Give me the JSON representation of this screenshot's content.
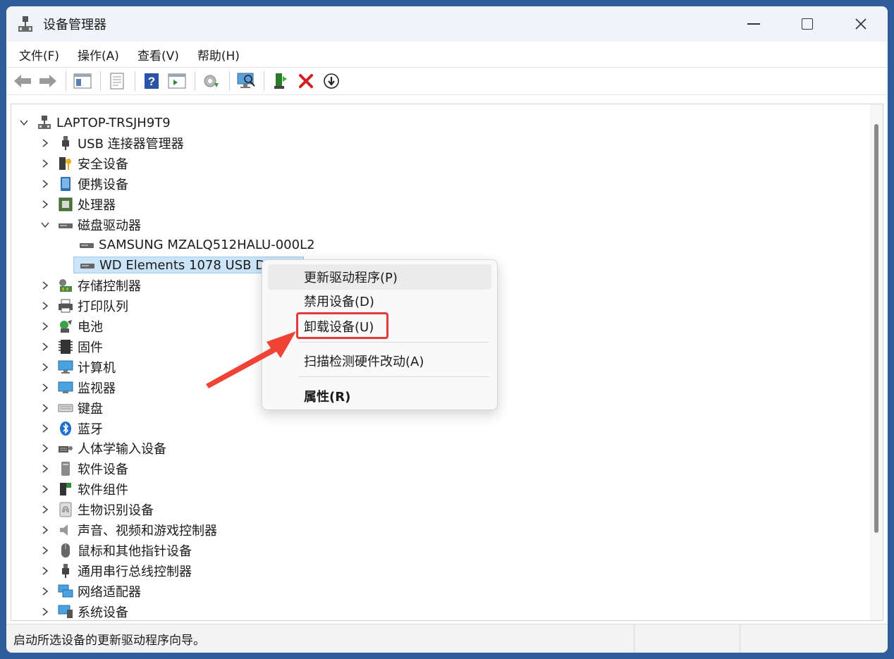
{
  "window": {
    "title": "设备管理器"
  },
  "menubar": [
    "文件(F)",
    "操作(A)",
    "查看(V)",
    "帮助(H)"
  ],
  "tree": {
    "root": "LAPTOP-TRSJH9T9",
    "items": [
      {
        "label": "USB 连接器管理器",
        "icon": "usb-connector-icon",
        "expanded": false
      },
      {
        "label": "安全设备",
        "icon": "security-device-icon",
        "expanded": false
      },
      {
        "label": "便携设备",
        "icon": "portable-device-icon",
        "expanded": false
      },
      {
        "label": "处理器",
        "icon": "processor-icon",
        "expanded": false
      },
      {
        "label": "磁盘驱动器",
        "icon": "disk-drive-icon",
        "expanded": true,
        "children": [
          "SAMSUNG MZALQ512HALU-000L2",
          "WD Elements 1078 USB Device"
        ]
      },
      {
        "label": "存储控制器",
        "icon": "storage-controller-icon",
        "expanded": false
      },
      {
        "label": "打印队列",
        "icon": "printer-icon",
        "expanded": false
      },
      {
        "label": "电池",
        "icon": "battery-icon",
        "expanded": false
      },
      {
        "label": "固件",
        "icon": "firmware-icon",
        "expanded": false
      },
      {
        "label": "计算机",
        "icon": "computer-icon",
        "expanded": false
      },
      {
        "label": "监视器",
        "icon": "monitor-icon",
        "expanded": false
      },
      {
        "label": "键盘",
        "icon": "keyboard-icon",
        "expanded": false
      },
      {
        "label": "蓝牙",
        "icon": "bluetooth-icon",
        "expanded": false
      },
      {
        "label": "人体学输入设备",
        "icon": "hid-icon",
        "expanded": false
      },
      {
        "label": "软件设备",
        "icon": "software-device-icon",
        "expanded": false
      },
      {
        "label": "软件组件",
        "icon": "software-component-icon",
        "expanded": false
      },
      {
        "label": "生物识别设备",
        "icon": "biometric-icon",
        "expanded": false
      },
      {
        "label": "声音、视频和游戏控制器",
        "icon": "audio-icon",
        "expanded": false
      },
      {
        "label": "鼠标和其他指针设备",
        "icon": "mouse-icon",
        "expanded": false
      },
      {
        "label": "通用串行总线控制器",
        "icon": "usb-controller-icon",
        "expanded": false
      },
      {
        "label": "网络适配器",
        "icon": "network-adapter-icon",
        "expanded": false
      },
      {
        "label": "系统设备",
        "icon": "system-device-icon",
        "expanded": false
      }
    ]
  },
  "context_menu": {
    "items": [
      "更新驱动程序(P)",
      "禁用设备(D)",
      "卸载设备(U)",
      "扫描检测硬件改动(A)",
      "属性(R)"
    ],
    "highlighted": "卸载设备(U)"
  },
  "status": {
    "text": "启动所选设备的更新驱动程序向导。"
  },
  "colors": {
    "accent": "#e33a3a",
    "selection": "#cce4f7",
    "border_frame": "#2f5d9c"
  }
}
